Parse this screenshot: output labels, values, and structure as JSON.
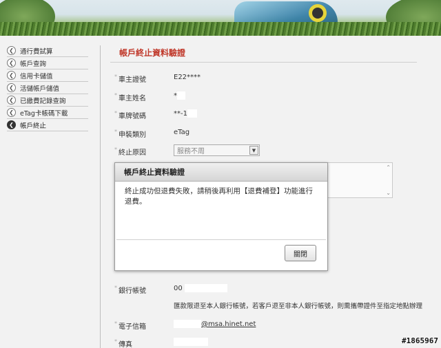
{
  "sidebar": {
    "items": [
      {
        "label": "通行費試算"
      },
      {
        "label": "帳戶查詢"
      },
      {
        "label": "信用卡儲值"
      },
      {
        "label": "活儲帳戶儲值"
      },
      {
        "label": "已繳費記錄查詢"
      },
      {
        "label": "eTag卡帳碼下載"
      },
      {
        "label": "帳戶終止"
      }
    ]
  },
  "main": {
    "title": "帳戶終止資料驗證",
    "fields": {
      "owner_id_label": "車主證號",
      "owner_id_value": "E22****",
      "owner_name_label": "車主姓名",
      "owner_name_value": "*",
      "plate_label": "車牌號碼",
      "plate_value": "**-1",
      "type_label": "申裝類別",
      "type_value": "eTag",
      "reason_label": "終止原因",
      "reason_value": "服務不周",
      "bank_account_label": "銀行帳號",
      "bank_account_value": "00",
      "email_label": "電子信箱",
      "email_value": "@msa.hinet.net",
      "fax_label": "傳真"
    },
    "refund_note": "匯款限退至本人銀行帳號，若客戶退至非本人銀行帳號，則需攜帶證件至指定地點辦理"
  },
  "dialog": {
    "title": "帳戶終止資料驗證",
    "message": "終止成功但退費失敗，請稍後再利用【退費補登】功能進行退費。",
    "close_label": "關閉"
  },
  "watermark": "#1865967"
}
